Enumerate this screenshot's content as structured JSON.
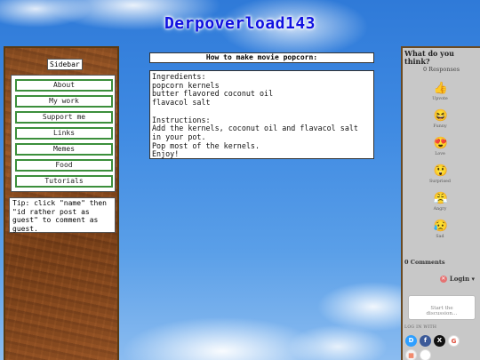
{
  "site": {
    "title": "Derpoverload143"
  },
  "sidebar": {
    "title": "Sidebar",
    "items": [
      {
        "label": "About"
      },
      {
        "label": "My work"
      },
      {
        "label": "Support me"
      },
      {
        "label": "Links"
      },
      {
        "label": "Memes"
      },
      {
        "label": "Food"
      },
      {
        "label": "Tutorials"
      }
    ],
    "tip": "Tip: click \"name\" then \"id rather post as guest\" to comment as guest."
  },
  "post": {
    "title": "How to make movie popcorn:",
    "body": "Ingredients:\npopcorn kernels\nbutter flavored coconut oil\nflavacol salt\n\nInstructions:\nAdd the kernels, coconut oil and flavacol salt in your pot.\nPop most of the kernels.\nEnjoy!"
  },
  "comments": {
    "prompt": "What do you think?",
    "responses": "0 Responses",
    "reactions": [
      {
        "label": "Upvote",
        "icon": "thumbs-up-icon",
        "glyph": "👍"
      },
      {
        "label": "Funny",
        "icon": "laughing-face-icon",
        "glyph": "😆"
      },
      {
        "label": "Love",
        "icon": "heart-eyes-icon",
        "glyph": "😍"
      },
      {
        "label": "Surprised",
        "icon": "surprised-face-icon",
        "glyph": "😲"
      },
      {
        "label": "Angry",
        "icon": "angry-face-icon",
        "glyph": "😤"
      },
      {
        "label": "Sad",
        "icon": "sad-face-icon",
        "glyph": "😥"
      }
    ],
    "count": "0 Comments",
    "login": "Login ▾",
    "placeholder": "Start the discussion…",
    "log_in_with": "LOG IN WITH",
    "socials": [
      {
        "name": "disqus-icon",
        "glyph": "D",
        "color": "#2e9fff"
      },
      {
        "name": "facebook-icon",
        "glyph": "f",
        "color": "#3b5998"
      },
      {
        "name": "x-icon",
        "glyph": "X",
        "color": "#111111"
      },
      {
        "name": "google-icon",
        "glyph": "G",
        "color": "#dd4b39"
      },
      {
        "name": "microsoft-icon",
        "glyph": "▦",
        "color": "#f3f3f3"
      },
      {
        "name": "apple-icon",
        "glyph": "",
        "color": "#000000"
      }
    ]
  }
}
